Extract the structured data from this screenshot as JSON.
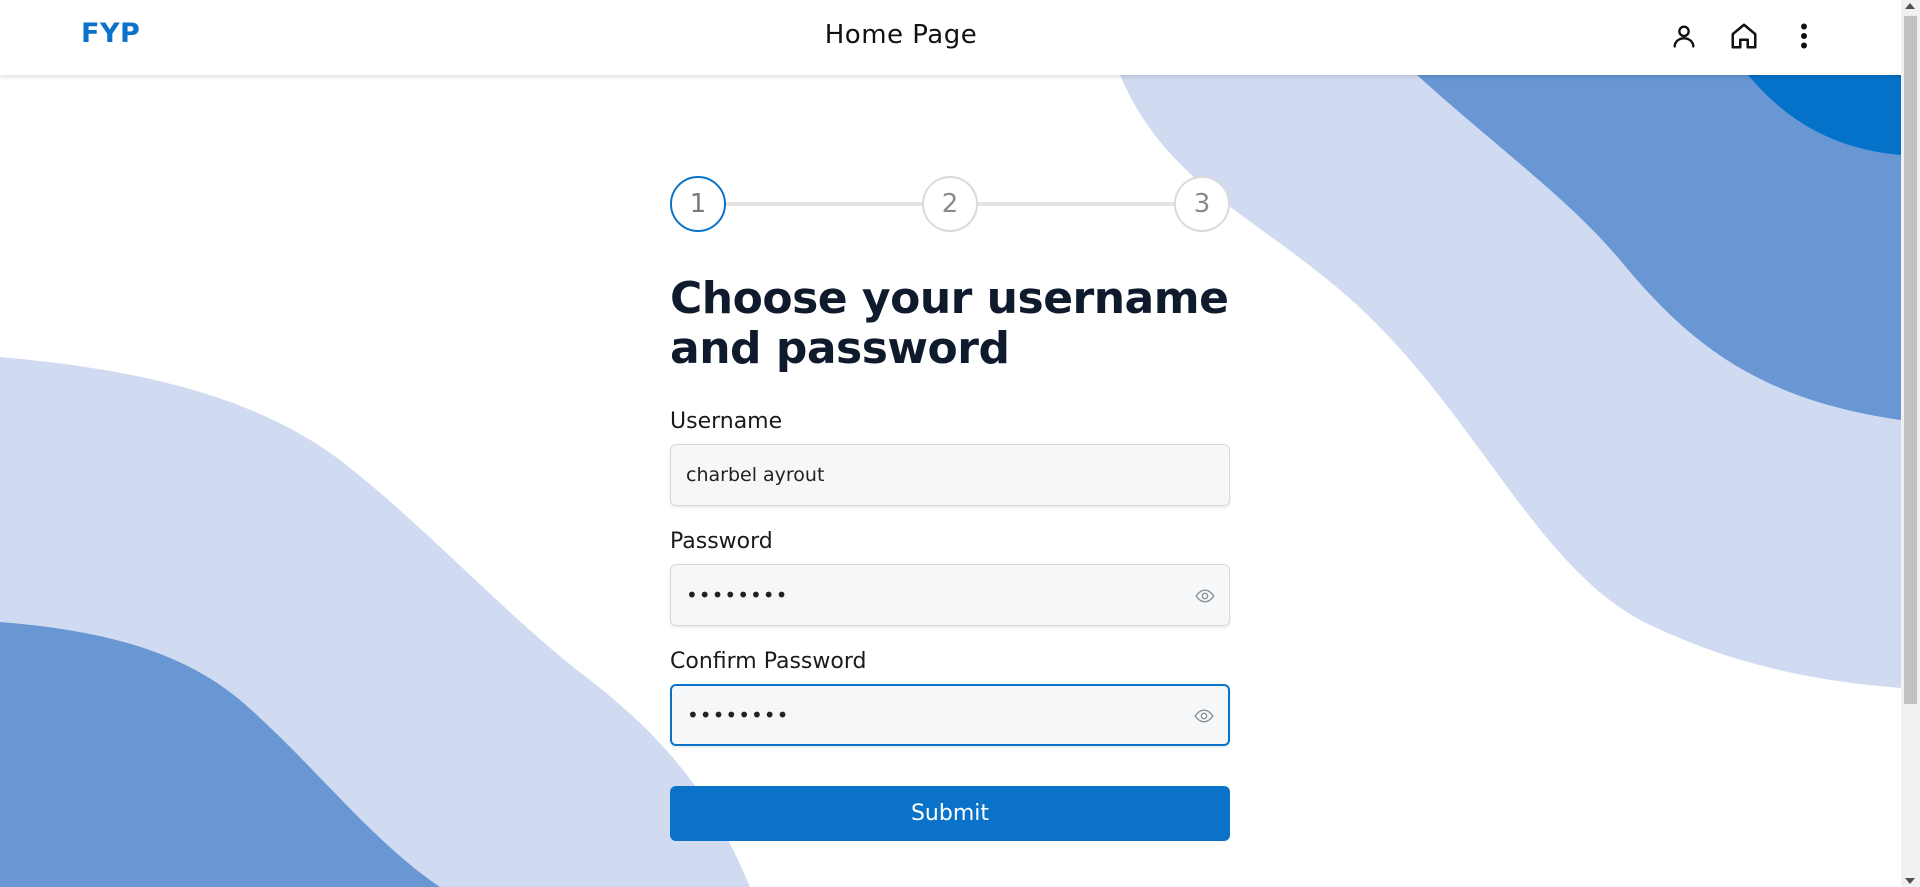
{
  "header": {
    "logo": "FYP",
    "title": "Home Page",
    "icons": [
      "user-icon",
      "home-icon",
      "more-vertical-icon"
    ]
  },
  "stepper": {
    "steps": [
      "1",
      "2",
      "3"
    ],
    "active_step": 1
  },
  "form": {
    "heading": "Choose your username and password",
    "username_label": "Username",
    "username_value": "charbel ayrout",
    "password_label": "Password",
    "password_value": "••••••••",
    "confirm_label": "Confirm Password",
    "confirm_value": "••••••••",
    "submit_label": "Submit"
  },
  "colors": {
    "accent": "#0a73c9",
    "wave_light": "#d0daf1",
    "wave_mid": "#6897d4",
    "wave_dark": "#0572c9"
  }
}
